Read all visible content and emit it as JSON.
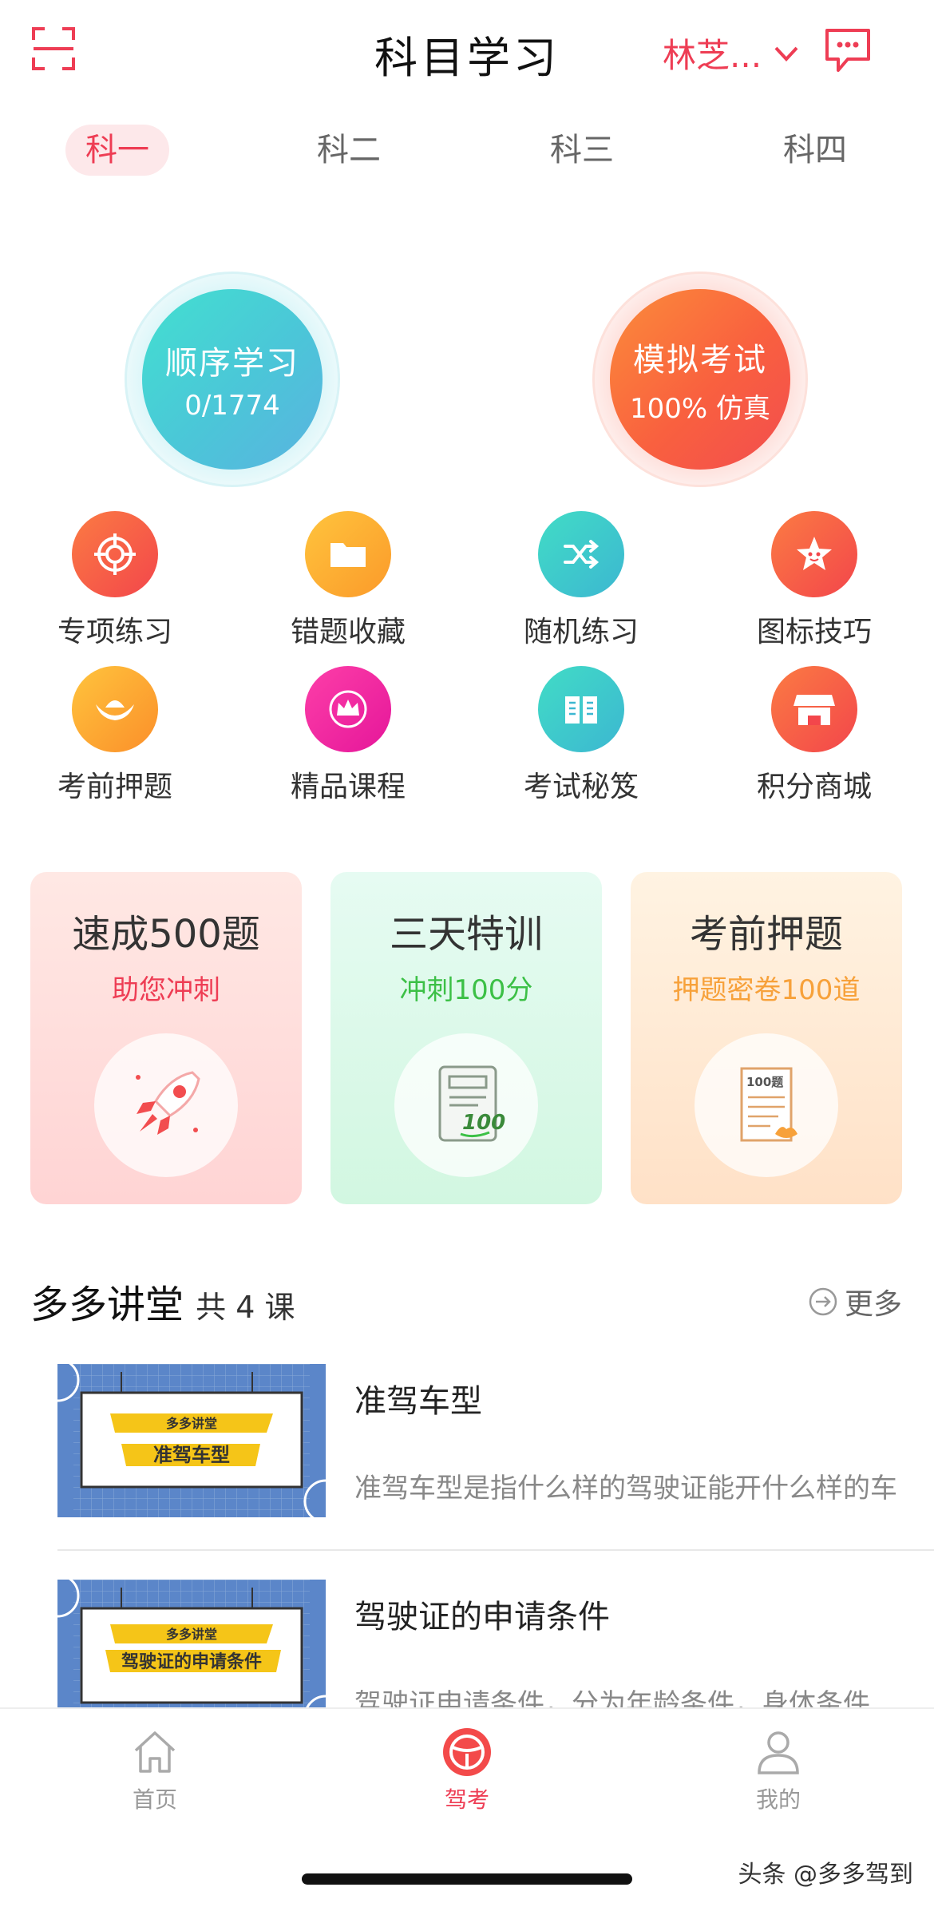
{
  "header": {
    "title": "科目学习",
    "user_name": "林芝...",
    "scan_icon": "scan-icon",
    "chat_icon": "message-icon"
  },
  "tabs": [
    {
      "label": "科一",
      "active": true
    },
    {
      "label": "科二",
      "active": false
    },
    {
      "label": "科三",
      "active": false
    },
    {
      "label": "科四",
      "active": false
    }
  ],
  "main_actions": {
    "sequential": {
      "title": "顺序学习",
      "progress": "0/1774"
    },
    "mock_exam": {
      "title": "模拟考试",
      "sub": "100% 仿真"
    }
  },
  "grid": [
    {
      "label": "专项练习",
      "icon": "target-icon"
    },
    {
      "label": "错题收藏",
      "icon": "folder-icon"
    },
    {
      "label": "随机练习",
      "icon": "shuffle-icon"
    },
    {
      "label": "图标技巧",
      "icon": "star-icon"
    },
    {
      "label": "考前押题",
      "icon": "ingot-icon"
    },
    {
      "label": "精品课程",
      "icon": "crown-icon"
    },
    {
      "label": "考试秘笈",
      "icon": "book-icon"
    },
    {
      "label": "积分商城",
      "icon": "shop-icon"
    }
  ],
  "cards": [
    {
      "title": "速成500题",
      "sub": "助您冲刺",
      "sub_color": "#ee3d54",
      "icon": "rocket-icon"
    },
    {
      "title": "三天特训",
      "sub": "冲刺100分",
      "sub_color": "#3cc046",
      "icon": "scroll-100-icon"
    },
    {
      "title": "考前押题",
      "sub": "押题密卷100道",
      "sub_color": "#f7a13a",
      "icon": "paper-100-icon",
      "badge": "100题"
    }
  ],
  "lecture": {
    "title": "多多讲堂",
    "count": "共 4 课",
    "more": "更多",
    "lessons": [
      {
        "name": "准驾车型",
        "desc": "准驾车型是指什么样的驾驶证能开什么样的车",
        "thumb_tag": "多多讲堂",
        "thumb_title": "准驾车型"
      },
      {
        "name": "驾驶证的申请条件",
        "desc": "驾驶证申请条件，分为年龄条件，身体条件",
        "thumb_tag": "多多讲堂",
        "thumb_title": "驾驶证的申请条件"
      }
    ]
  },
  "bottom_nav": [
    {
      "label": "首页",
      "icon": "home-icon",
      "active": false
    },
    {
      "label": "驾考",
      "icon": "steering-wheel-icon",
      "active": true
    },
    {
      "label": "我的",
      "icon": "user-icon",
      "active": false
    }
  ],
  "watermark": "头条 @多多驾到",
  "colors": {
    "accent": "#ee3d54",
    "teal": "#4ecfcf",
    "orange": "#fa6a3c"
  }
}
